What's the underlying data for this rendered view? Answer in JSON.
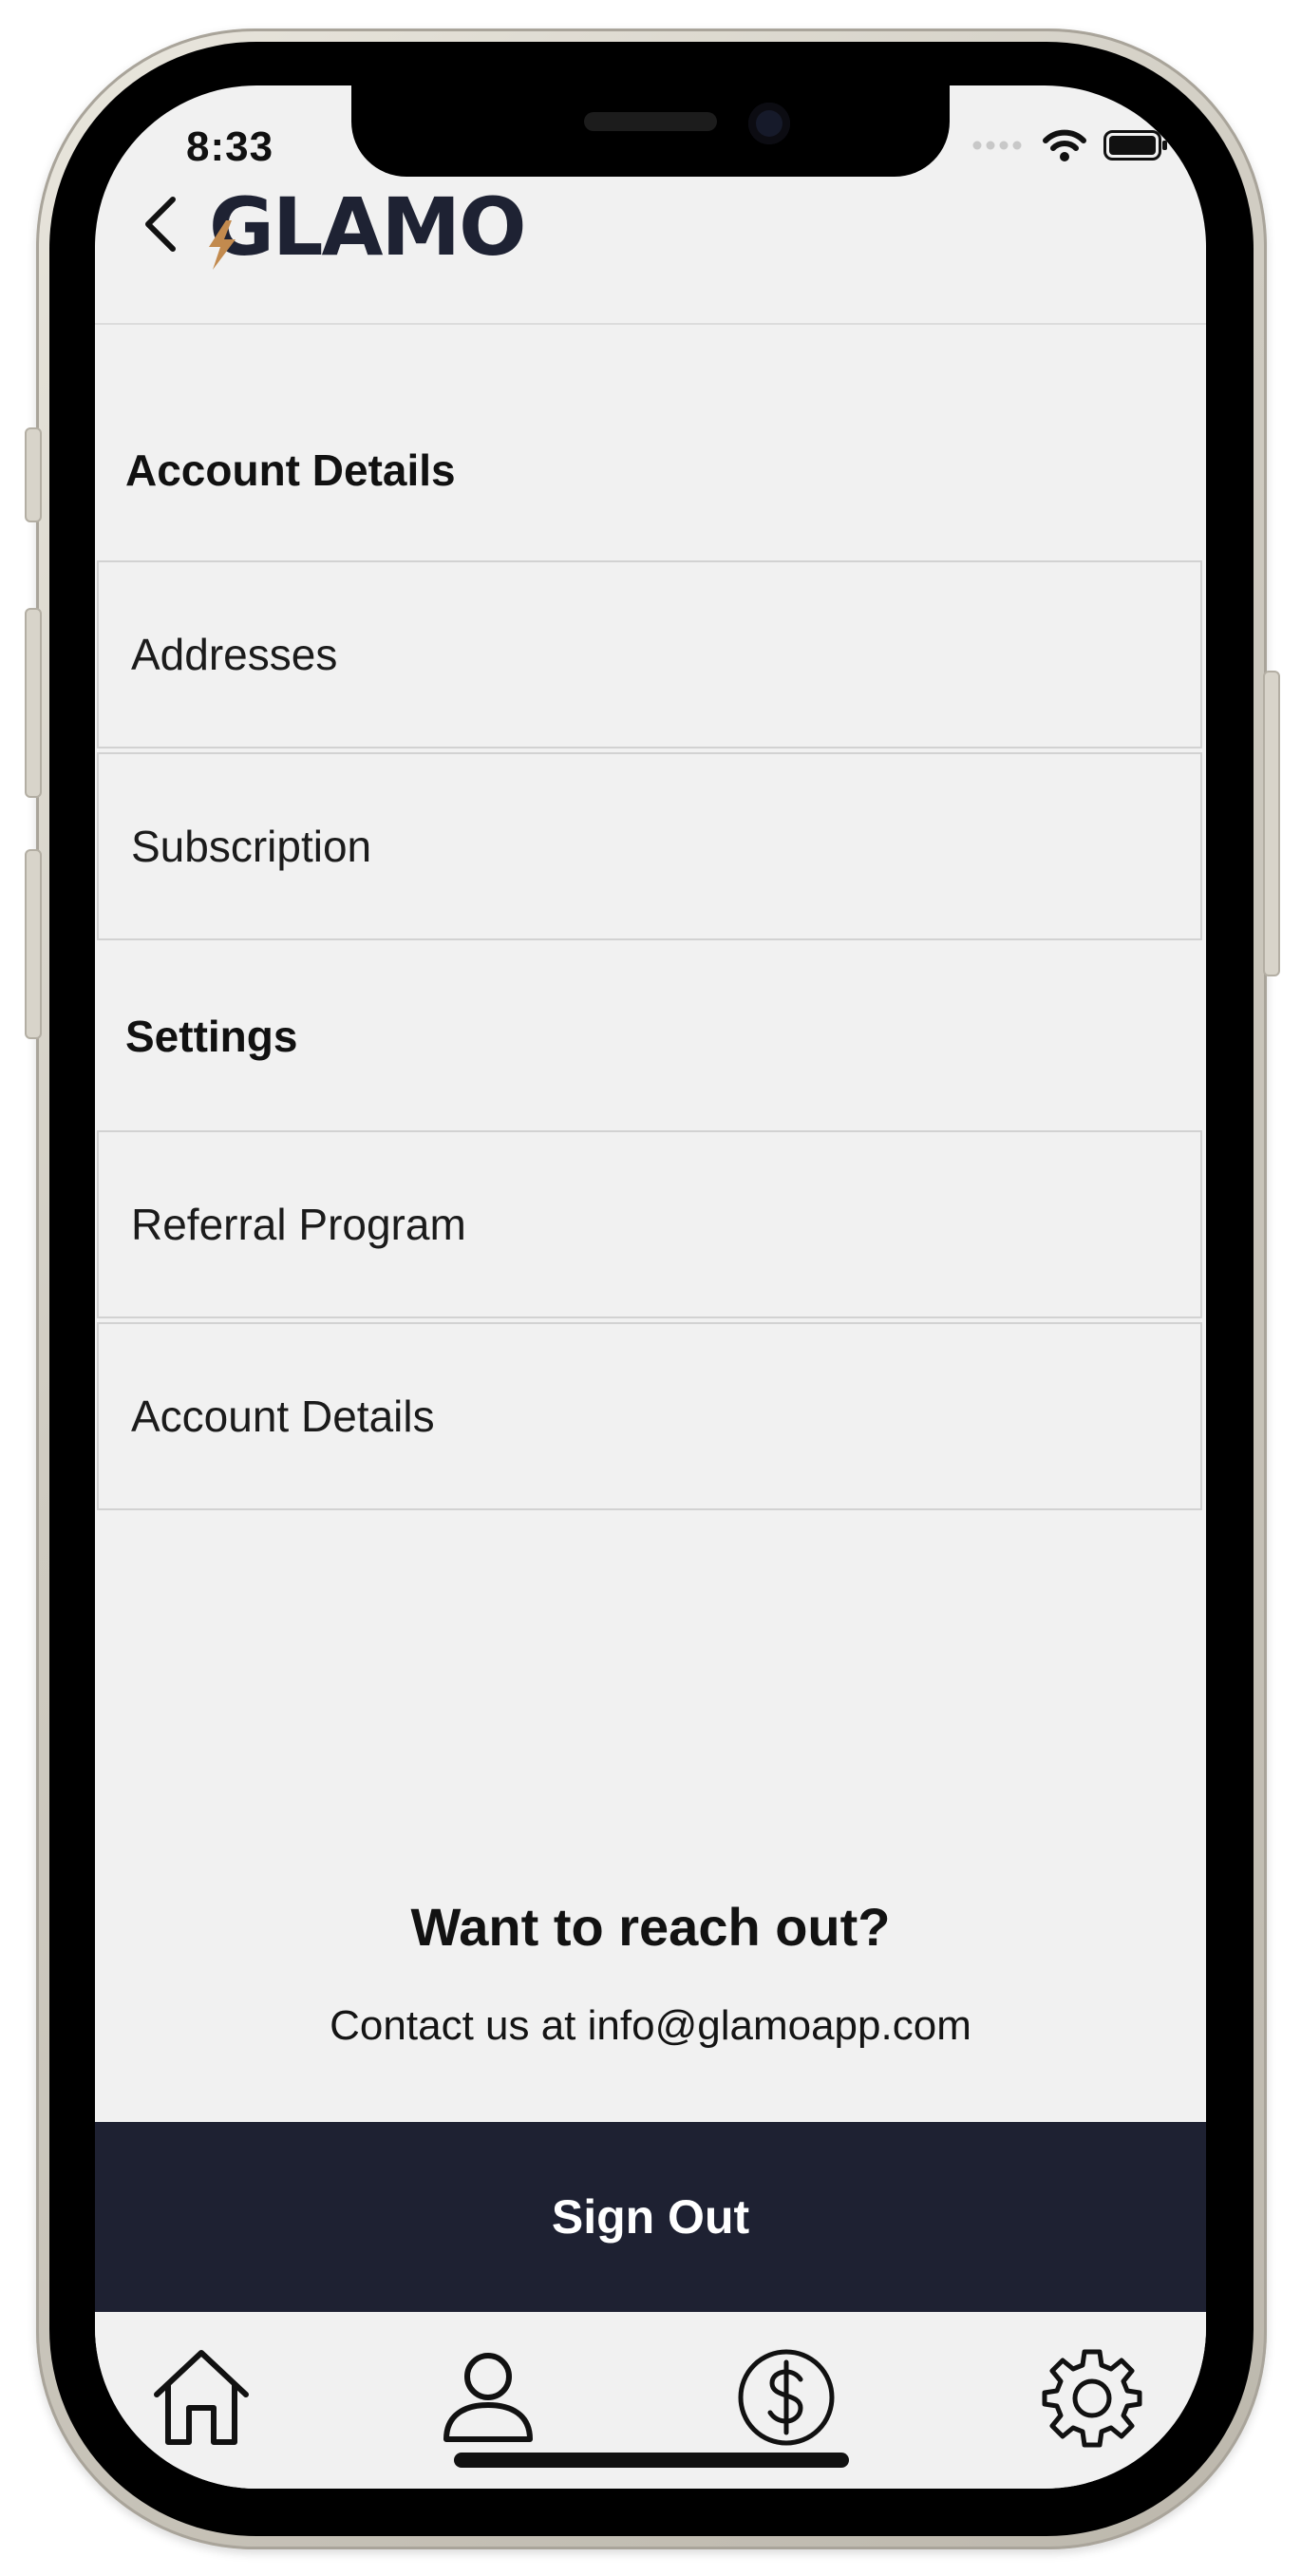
{
  "status_bar": {
    "time": "8:33"
  },
  "header": {
    "logo_text": "GLAMO"
  },
  "sections": [
    {
      "heading": "Account Details",
      "items": [
        "Addresses",
        "Subscription"
      ]
    },
    {
      "heading": "Settings",
      "items": [
        "Referral Program",
        "Account Details"
      ]
    }
  ],
  "contact": {
    "title": "Want to reach out?",
    "text": "Contact us at info@glamoapp.com"
  },
  "sign_out_label": "Sign Out",
  "tab_bar": {
    "tabs": [
      "home-icon",
      "profile-icon",
      "dollar-icon",
      "settings-icon"
    ]
  },
  "colors": {
    "brand_dark": "#1e2132",
    "accent": "#c28a4e",
    "background": "#f1f1f1"
  }
}
